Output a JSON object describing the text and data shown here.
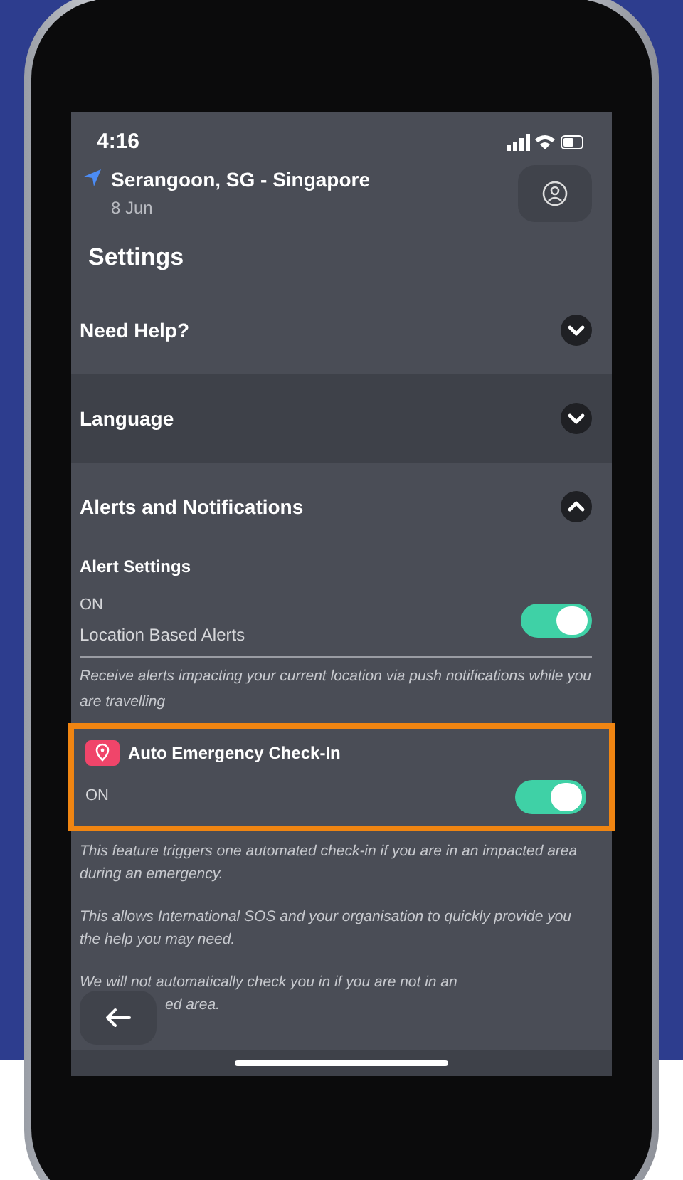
{
  "status_bar": {
    "time": "4:16"
  },
  "location": {
    "place": "Serangoon, SG - Singapore",
    "date": "8 Jun"
  },
  "title": "Settings",
  "sections": [
    {
      "label": "Need Help?",
      "expanded": false,
      "selected": false
    },
    {
      "label": "Language",
      "expanded": false,
      "selected": true
    },
    {
      "label": "Alerts and Notifications",
      "expanded": true,
      "selected": false
    }
  ],
  "alert_settings": {
    "heading": "Alert Settings",
    "state_text": "ON",
    "label": "Location Based Alerts",
    "on": true,
    "note": "Receive alerts impacting your current location via push notifications while you are travelling"
  },
  "auto_checkin": {
    "label": "Auto Emergency Check-In",
    "state_text": "ON",
    "on": true,
    "highlighted": true
  },
  "paragraphs": [
    "This feature triggers one automated check-in if you are in an impacted area during an emergency.",
    "This allows International SOS and your organisation to quickly provide you the help you may need."
  ],
  "last_paragraph": {
    "line_1": "We will not automatically check you in if you are not in an",
    "line_2": "ed area."
  }
}
